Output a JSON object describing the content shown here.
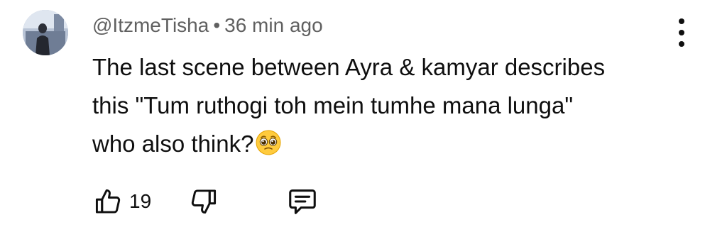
{
  "comment": {
    "author": "@ItzmeTisha",
    "separator": "•",
    "time_ago": "36 min ago",
    "text_lines": [
      "The last scene between Ayra & kamyar describes",
      "this \"Tum ruthogi toh mein tumhe mana lunga\"",
      "who also think?"
    ],
    "emoji": "pleading-face-emoji",
    "avatar": "profile-photo"
  },
  "actions": {
    "like_icon": "thumbs-up-icon",
    "like_count": "19",
    "dislike_icon": "thumbs-down-icon",
    "reply_icon": "comment-reply-icon"
  },
  "menu": {
    "icon": "more-vertical-icon"
  }
}
